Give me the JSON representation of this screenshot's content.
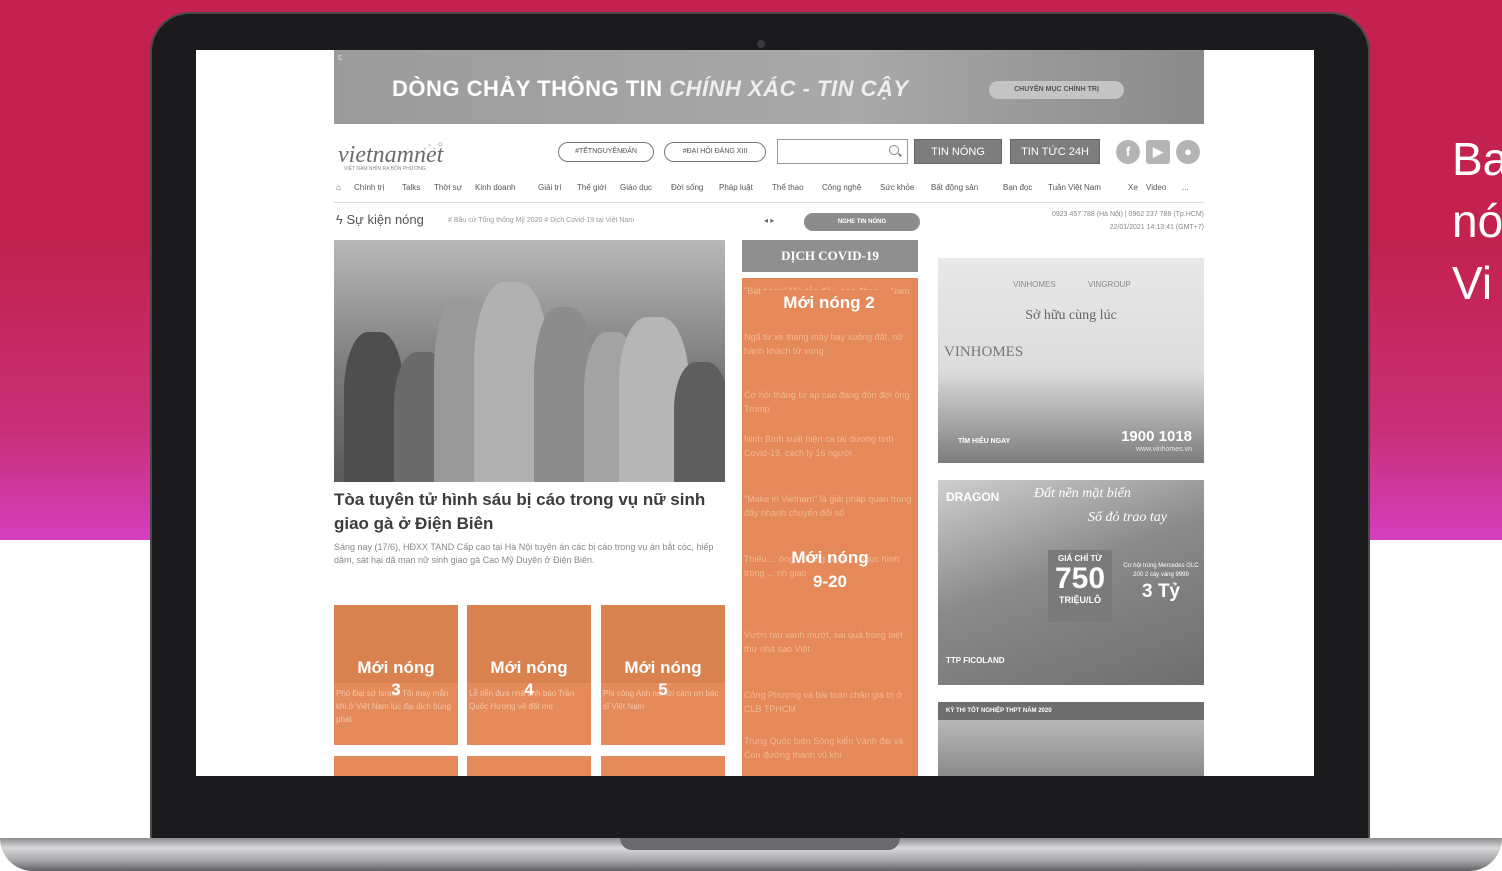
{
  "side_text": [
    "Ba",
    "nó",
    "Vi"
  ],
  "banner": {
    "corner": "c",
    "title_main": "DÒNG CHẢY THÔNG TIN ",
    "title_italic": "CHÍNH XÁC - TIN CẬY",
    "button": "CHUYÊN MỤC CHÍNH TRỊ"
  },
  "logo": {
    "text": "vietnamnet",
    "subtitle": "VIỆT NAM NHÌN RA BỐN PHƯƠNG"
  },
  "header": {
    "pills": [
      "#TẾTNGUYÊNĐÁN",
      "#ĐẠI HỘI ĐẢNG XIII"
    ],
    "search_placeholder": "",
    "hot_button": "TIN NÓNG",
    "news24_button": "TIN TỨC 24H"
  },
  "nav": [
    "Chính trị",
    "Talks",
    "Thời sự",
    "Kinh doanh",
    "Giải trí",
    "Thế giới",
    "Giáo dục",
    "Đời sống",
    "Pháp luật",
    "Thể thao",
    "Công nghệ",
    "Sức khỏe",
    "Bất động sản",
    "Bạn đọc",
    "Tuần Việt Nam",
    "Xe",
    "Video",
    "..."
  ],
  "events": {
    "label": "Sự kiện nóng",
    "tags": "# Bầu cử Tổng thống Mỹ 2020   # Dịch Covid-19 tại Việt Nam",
    "arrows": "◂ ▸",
    "listen_button": "NGHE TIN NÓNG",
    "contact": "0923 457 788 (Hà Nội) | 0962 237 788 (Tp.HCM)",
    "datetime": "22/01/2021 14:13:41 (GMT+7)"
  },
  "hero": {
    "title": "Tòa tuyên tử hình sáu bị cáo trong vụ nữ sinh giao gà ở Điện Biên",
    "desc": "Sáng nay (17/6), HĐXX TAND Cấp cao tại Hà Nội tuyên án các bị cáo trong vụ án bắt cóc, hiếp dâm, sát hại dã man nữ sinh giao gà Cao Mỹ Duyên ở Điện Biên."
  },
  "tiles": [
    {
      "label_line1": "Mới nóng",
      "label_line2": "3",
      "caption": "Phó Đại sứ Israel: Tôi may mắn khi ở Việt Nam lúc đại dịch bùng phát"
    },
    {
      "label_line1": "Mới nóng",
      "label_line2": "4",
      "caption": "Lễ tiễn đưa nhà tình báo Trần Quốc Hương về đất mẹ"
    },
    {
      "label_line1": "Mới nóng",
      "label_line2": "5",
      "caption": "Phi công Anh nói lời cảm ơn bác sĩ Việt Nam"
    }
  ],
  "covid": {
    "header": "DỊCH COVID-19",
    "label_top": "Mới nóng 2",
    "label_mid_line1": "Mới nóng",
    "label_mid_line2": "9-20",
    "items": [
      "\"Bạt hàng\" Mỹ dẫn đầu, kéo động ... Nam",
      "Ngã từ xe thang máy bay xuống đất, nữ hành khách tử vong",
      "Cơ hội thăng từ áp cáo đang đón đợi ông Trump",
      "Ninh Bình xuất hiện ca tái dương tính Covid-19, cách ly 16 người",
      "\"Make in Vietnam\" là giải pháp quan trọng đẩy nhanh chuyển đổi số",
      "Thiếu ... ông: Không có gì ... nhục hình trong ... nh giao",
      "Vườn rau xanh mướt, sai quả trong biệt thự nhà sao Việt",
      "Công Phượng và bài toán chân giá trị ở CLB TPHCM",
      "Trung Quốc biên Sông kiến Vành đai và Con đường thành vũ khí"
    ]
  },
  "ad_vinhomes": {
    "brand": "VINHOMES",
    "brand2": "VINGROUP",
    "slogan": "Sở hữu cùng lúc",
    "name": "VINHOMES",
    "cta": "TÌM HIỂU NGAY",
    "phone": "1900 1018",
    "web": "www.vinhomes.vn"
  },
  "ad_dragon": {
    "brand": "DRAGON",
    "slogan1": "Đất nền mặt biển",
    "slogan2": "Sổ đỏ trao tay",
    "price_top": "GIÁ CHỈ TỪ",
    "price": "750",
    "price_unit": "TRIỆU/LÔ",
    "prize_text": "Cơ hội trúng Mercedes GLC 200 2 cây vàng 9999",
    "prize_total": "3 Tỷ",
    "footer": "TTP  FICOLAND"
  },
  "exam": {
    "header": "KỲ THI TỐT NGHIỆP THPT NĂM 2020"
  }
}
